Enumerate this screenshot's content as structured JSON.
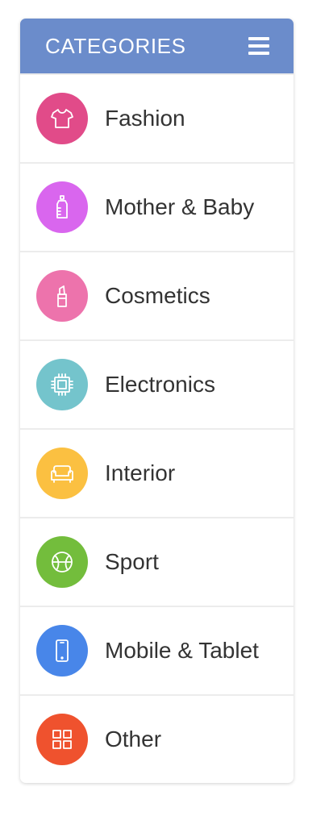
{
  "header": {
    "title": "CATEGORIES",
    "menu_icon": "hamburger-menu-icon",
    "color": "#6b8ccb"
  },
  "categories": [
    {
      "label": "Fashion",
      "icon": "tshirt-icon",
      "color": "#e14b89"
    },
    {
      "label": "Mother & Baby",
      "icon": "baby-bottle-icon",
      "color": "#d966ee"
    },
    {
      "label": "Cosmetics",
      "icon": "lipstick-icon",
      "color": "#ed73ac"
    },
    {
      "label": "Electronics",
      "icon": "chip-icon",
      "color": "#74c4cc"
    },
    {
      "label": "Interior",
      "icon": "sofa-icon",
      "color": "#fbc041"
    },
    {
      "label": "Sport",
      "icon": "ball-icon",
      "color": "#73bd3c"
    },
    {
      "label": "Mobile & Tablet",
      "icon": "smartphone-icon",
      "color": "#4886e9"
    },
    {
      "label": "Other",
      "icon": "grid-icon",
      "color": "#ef522e"
    }
  ]
}
